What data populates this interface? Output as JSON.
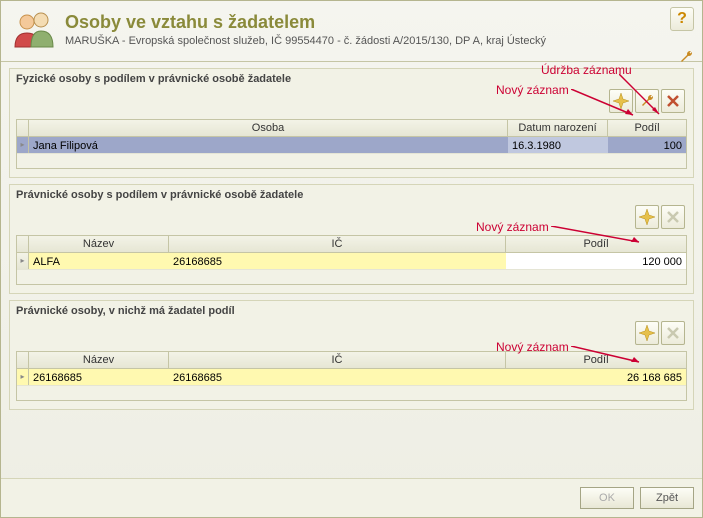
{
  "header": {
    "title": "Osoby ve vztahu s žadatelem",
    "subtitle": "MARUŠKA - Evropská společnost služeb, IČ 99554470 - č. žádosti A/2015/130, DP A, kraj Ústecký"
  },
  "annotations": {
    "udrzba": "Údržba záznamu",
    "novy": "Nový záznam"
  },
  "section1": {
    "title": "Fyzické osoby s podílem v právnické osobě žadatele",
    "columns": {
      "c1": "Osoba",
      "c2": "Datum narození",
      "c3": "Podíl"
    },
    "rows": [
      {
        "osoba": "Jana Filipová",
        "datum": "16.3.1980",
        "podil": "100"
      }
    ]
  },
  "section2": {
    "title": "Právnické osoby s podílem v právnické osobě žadatele",
    "columns": {
      "c1": "Název",
      "c2": "IČ",
      "c3": "Podíl"
    },
    "rows": [
      {
        "nazev": "ALFA",
        "ic": "26168685",
        "podil": "120 000"
      }
    ]
  },
  "section3": {
    "title": "Právnické osoby, v nichž má žadatel podíl",
    "columns": {
      "c1": "Název",
      "c2": "IČ",
      "c3": "Podíl"
    },
    "rows": [
      {
        "nazev": "26168685",
        "ic": "26168685",
        "podil": "26 168 685"
      }
    ]
  },
  "footer": {
    "ok": "OK",
    "back": "Zpět"
  }
}
